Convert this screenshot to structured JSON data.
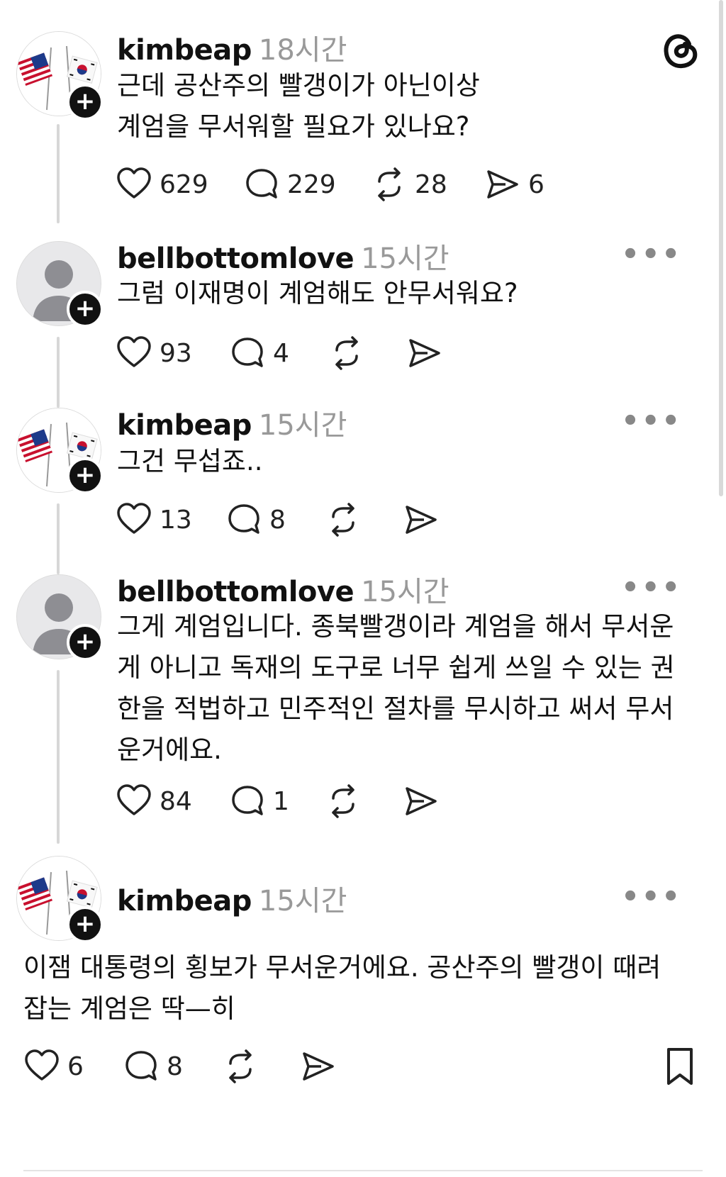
{
  "app": {
    "logo_icon": "threads-logo-icon"
  },
  "colors": {
    "text": "#111111",
    "meta": "#999999",
    "thread_line": "#d7d7d7"
  },
  "posts": [
    {
      "username": "kimbeap",
      "time": "18시간",
      "avatar": "flags",
      "lines": [
        "근데 공산주의 빨갱이가 아닌이상",
        "계엄을 무서워할 필요가 있나요?"
      ],
      "likes": "629",
      "replies": "229",
      "reposts": "28",
      "shares": "6"
    },
    {
      "username": "bellbottomlove",
      "time": "15시간",
      "avatar": "default",
      "lines": [
        "그럼 이재명이 계엄해도 안무서워요?"
      ],
      "likes": "93",
      "replies": "4",
      "reposts": "",
      "shares": ""
    },
    {
      "username": "kimbeap",
      "time": "15시간",
      "avatar": "flags",
      "lines": [
        "그건 무섭죠.."
      ],
      "likes": "13",
      "replies": "8",
      "reposts": "",
      "shares": ""
    },
    {
      "username": "bellbottomlove",
      "time": "15시간",
      "avatar": "default",
      "lines": [
        "그게 계엄입니다. 종북빨갱이라 계엄을 해서 무서운",
        "게 아니고 독재의 도구로 너무 쉽게 쓰일 수 있는 권",
        "한을 적법하고 민주적인 절차를 무시하고 써서 무서",
        "운거에요."
      ],
      "likes": "84",
      "replies": "1",
      "reposts": "",
      "shares": ""
    },
    {
      "username": "kimbeap",
      "time": "15시간",
      "avatar": "flags",
      "lines": [
        "이잼 대통령의 횡보가 무서운거에요. 공산주의 빨갱이 때려",
        "잡는 계엄은 딱—히"
      ],
      "likes": "6",
      "replies": "8",
      "reposts": "",
      "shares": ""
    }
  ],
  "more_label": "•••"
}
